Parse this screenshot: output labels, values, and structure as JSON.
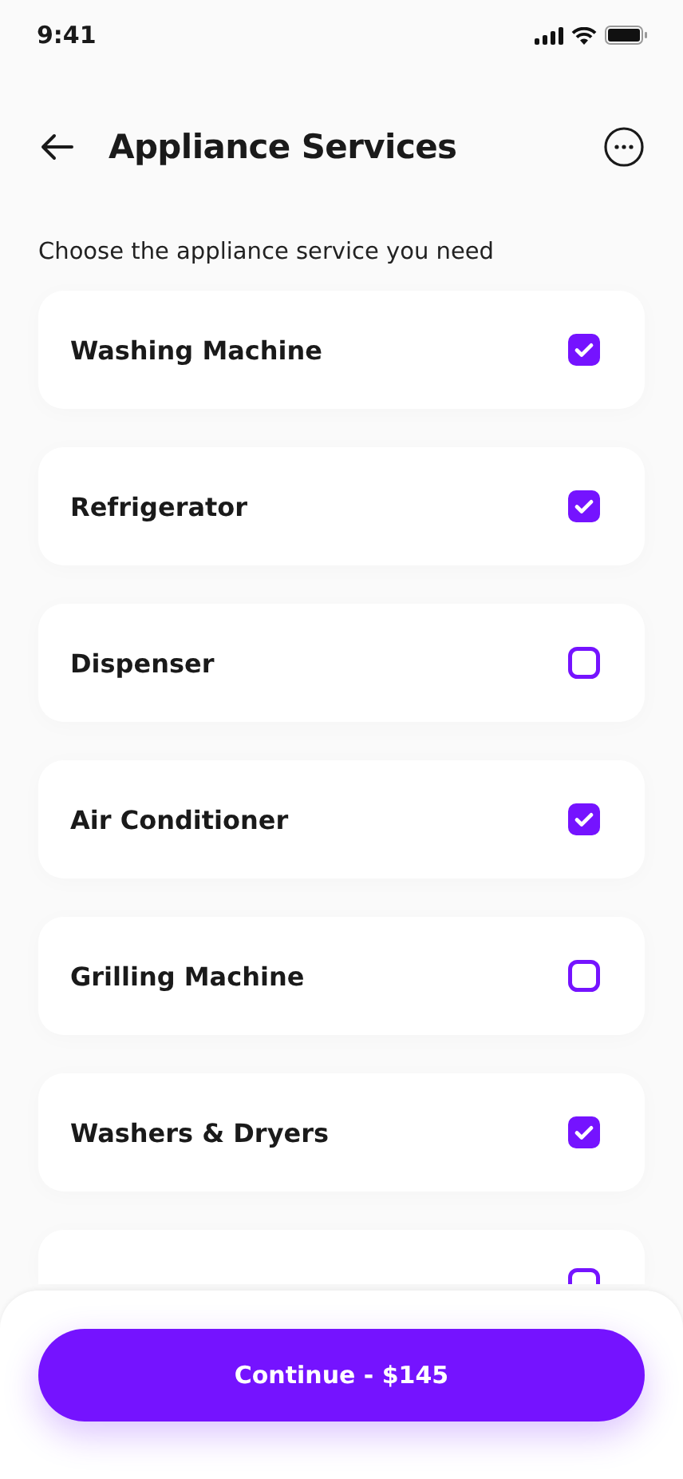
{
  "status_bar": {
    "time": "9:41"
  },
  "header": {
    "title": "Appliance Services"
  },
  "subtitle": "Choose the appliance service you need",
  "services": [
    {
      "label": "Washing Machine",
      "checked": true
    },
    {
      "label": "Refrigerator",
      "checked": true
    },
    {
      "label": "Dispenser",
      "checked": false
    },
    {
      "label": "Air Conditioner",
      "checked": true
    },
    {
      "label": "Grilling Machine",
      "checked": false
    },
    {
      "label": "Washers & Dryers",
      "checked": true
    },
    {
      "checked": false
    }
  ],
  "continue_button": {
    "label": "Continue - $145"
  }
}
